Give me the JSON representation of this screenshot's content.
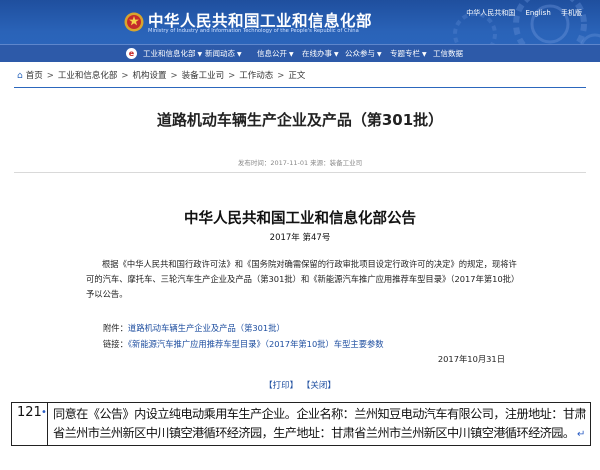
{
  "header": {
    "title_cn": "中华人民共和国工业和信息化部",
    "title_en": "Ministry of Industry and Information Technology of the People's Republic of China",
    "top_links": [
      "中华人民共和国",
      "English",
      "手机版"
    ]
  },
  "nav": {
    "items": [
      "工业和信息化部",
      "新闻动态",
      "信息公开",
      "在线办事",
      "公众参与",
      "专题专栏",
      "工信数据"
    ]
  },
  "breadcrumb": [
    "首页",
    "工业和信息化部",
    "机构设置",
    "装备工业司",
    "工作动态",
    "正文"
  ],
  "article": {
    "title": "道路机动车辆生产企业及产品（第301批）",
    "meta": "发布时间：2017-11-01  来源：装备工业司",
    "notice_title": "中华人民共和国工业和信息化部公告",
    "notice_no": "2017年  第47号",
    "body": "根据《中华人民共和国行政许可法》和《国务院对确需保留的行政审批项目设定行政许可的决定》的规定，现将许可的汽车、摩托车、三轮汽车生产企业及产品（第301批）和《新能源汽车推广应用推荐车型目录》（2017年第10批）予以公告。",
    "attachment_label": "附件：",
    "attachment_link": "道路机动车辆生产企业及产品（第301批）",
    "link_label": "链接：",
    "link_text": "《新能源汽车推广应用推荐车型目录》（2017年第10批）车型主要参数",
    "date": "2017年10月31日",
    "print": "【打印】",
    "close": "【关闭】"
  },
  "table_row": {
    "number": "121",
    "text": "同意在《公告》内设立纯电动乘用车生产企业。企业名称：兰州知豆电动汽车有限公司，注册地址：甘肃省兰州市兰州新区中川镇空港循环经济园，生产地址：甘肃省兰州市兰州新区中川镇空港循环经济园。"
  }
}
